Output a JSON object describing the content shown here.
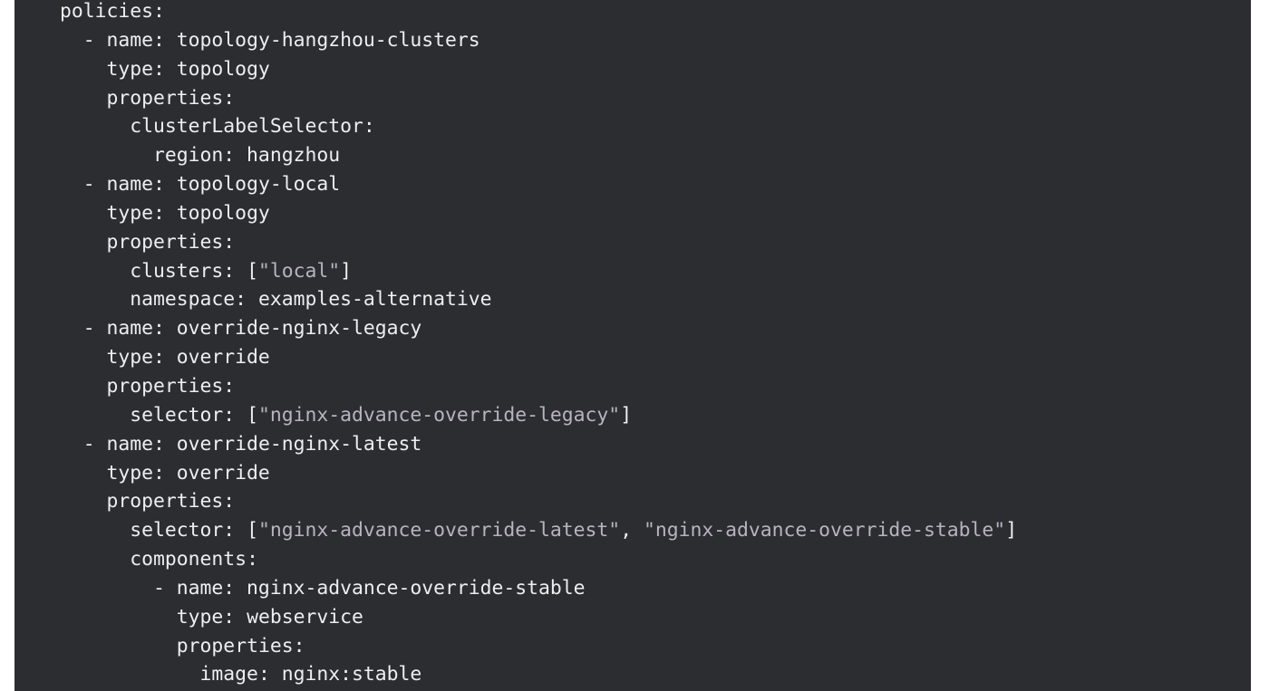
{
  "code": {
    "language": "yaml",
    "lines": [
      {
        "indent": 0,
        "tokens": [
          {
            "t": "policies:"
          }
        ]
      },
      {
        "indent": 1,
        "tokens": [
          {
            "t": "- name: topology-hangzhou-clusters"
          }
        ]
      },
      {
        "indent": 2,
        "tokens": [
          {
            "t": "type: topology"
          }
        ]
      },
      {
        "indent": 2,
        "tokens": [
          {
            "t": "properties:"
          }
        ]
      },
      {
        "indent": 3,
        "tokens": [
          {
            "t": "clusterLabelSelector:"
          }
        ]
      },
      {
        "indent": 4,
        "tokens": [
          {
            "t": "region: hangzhou"
          }
        ]
      },
      {
        "indent": 1,
        "tokens": [
          {
            "t": "- name: topology-local"
          }
        ]
      },
      {
        "indent": 2,
        "tokens": [
          {
            "t": "type: topology"
          }
        ]
      },
      {
        "indent": 2,
        "tokens": [
          {
            "t": "properties:"
          }
        ]
      },
      {
        "indent": 3,
        "tokens": [
          {
            "t": "clusters: ["
          },
          {
            "t": "\"local\"",
            "s": true
          },
          {
            "t": "]"
          }
        ]
      },
      {
        "indent": 3,
        "tokens": [
          {
            "t": "namespace: examples-alternative"
          }
        ]
      },
      {
        "indent": 1,
        "tokens": [
          {
            "t": "- name: override-nginx-legacy"
          }
        ]
      },
      {
        "indent": 2,
        "tokens": [
          {
            "t": "type: override"
          }
        ]
      },
      {
        "indent": 2,
        "tokens": [
          {
            "t": "properties:"
          }
        ]
      },
      {
        "indent": 3,
        "tokens": [
          {
            "t": "selector: ["
          },
          {
            "t": "\"nginx-advance-override-legacy\"",
            "s": true
          },
          {
            "t": "]"
          }
        ]
      },
      {
        "indent": 1,
        "tokens": [
          {
            "t": "- name: override-nginx-latest"
          }
        ]
      },
      {
        "indent": 2,
        "tokens": [
          {
            "t": "type: override"
          }
        ]
      },
      {
        "indent": 2,
        "tokens": [
          {
            "t": "properties:"
          }
        ]
      },
      {
        "indent": 3,
        "tokens": [
          {
            "t": "selector: ["
          },
          {
            "t": "\"nginx-advance-override-latest\"",
            "s": true
          },
          {
            "t": ", "
          },
          {
            "t": "\"nginx-advance-override-stable\"",
            "s": true
          },
          {
            "t": "]"
          }
        ]
      },
      {
        "indent": 3,
        "tokens": [
          {
            "t": "components:"
          }
        ]
      },
      {
        "indent": 4,
        "tokens": [
          {
            "t": "- name: nginx-advance-override-stable"
          }
        ]
      },
      {
        "indent": 5,
        "tokens": [
          {
            "t": "type: webservice"
          }
        ]
      },
      {
        "indent": 5,
        "tokens": [
          {
            "t": "properties:"
          }
        ]
      },
      {
        "indent": 6,
        "tokens": [
          {
            "t": "image: nginx:stable"
          }
        ]
      }
    ]
  },
  "colors": {
    "background": "#2b2d31",
    "text": "#eeeeee",
    "string": "#b9b3bf"
  }
}
